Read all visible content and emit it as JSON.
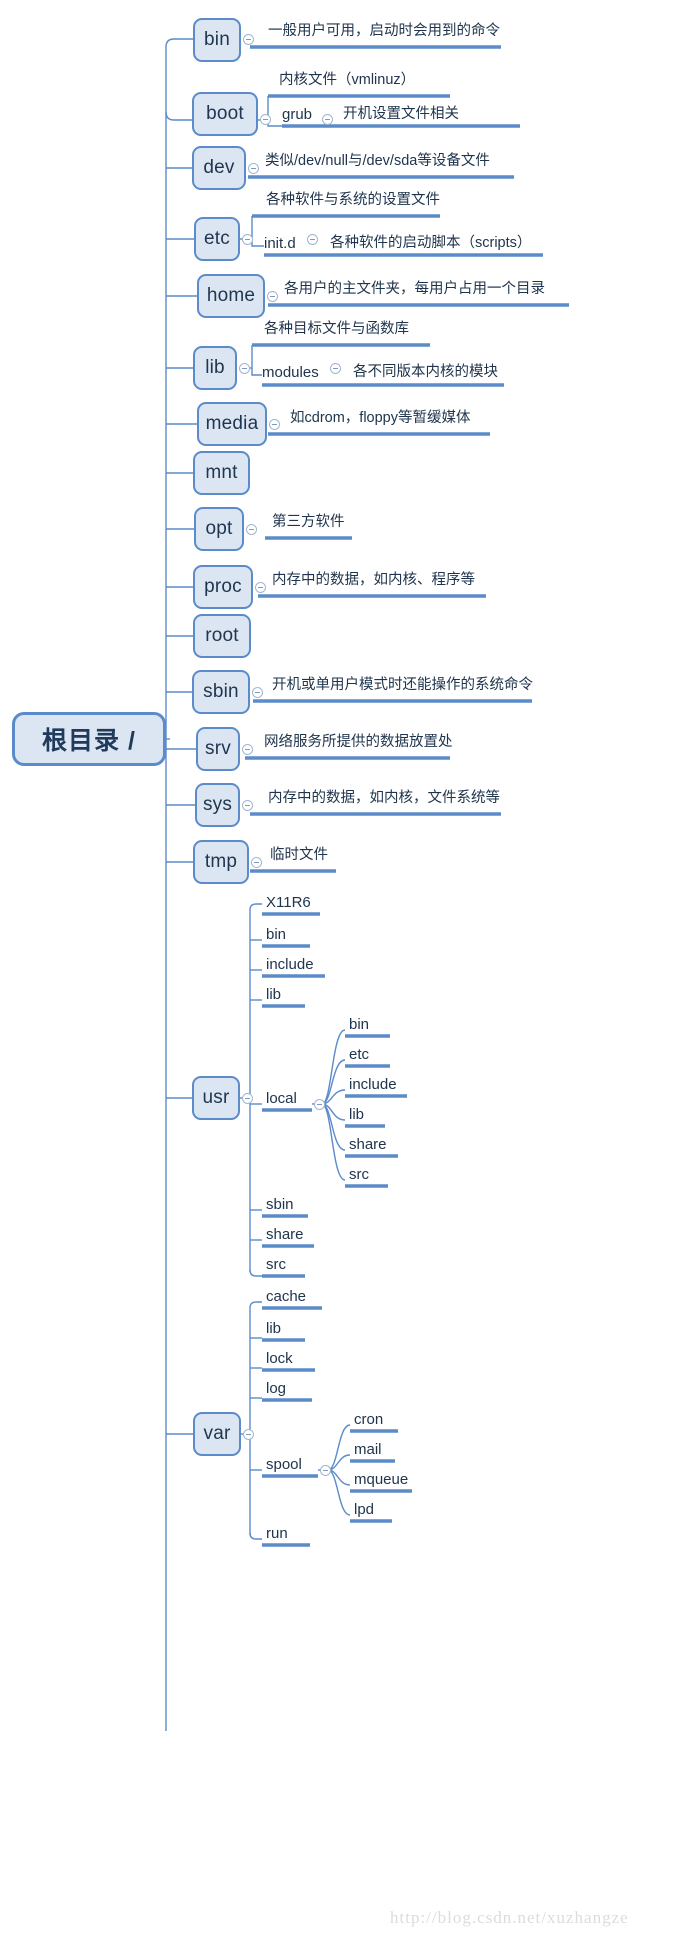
{
  "meta": {
    "title": "Linux 根目录结构思维导图",
    "watermark": "http://blog.csdn.net/xuzhangze",
    "colors": {
      "node_fill": "#dce6f2",
      "node_border": "#5b8bc9",
      "wire": "#5b8bc9",
      "underline": "#5b8bc9",
      "text": "#20354d",
      "watermark": "#dcdcdc",
      "background": "#ffffff"
    }
  },
  "root": {
    "label": "根目录 /"
  },
  "branches": [
    {
      "id": "bin",
      "label": "bin",
      "note": "一般用户可用，启动时会用到的命令",
      "children": []
    },
    {
      "id": "boot",
      "label": "boot",
      "note": "内核文件（vmlinuz）",
      "children": [
        {
          "label": "grub",
          "note": "开机设置文件相关"
        }
      ]
    },
    {
      "id": "dev",
      "label": "dev",
      "note": "类似/dev/null与/dev/sda等设备文件",
      "children": []
    },
    {
      "id": "etc",
      "label": "etc",
      "note": "各种软件与系统的设置文件",
      "children": [
        {
          "label": "init.d",
          "note": "各种软件的启动脚本（scripts）"
        }
      ]
    },
    {
      "id": "home",
      "label": "home",
      "note": "各用户的主文件夹，每用户占用一个目录",
      "children": []
    },
    {
      "id": "lib",
      "label": "lib",
      "note": "各种目标文件与函数库",
      "children": [
        {
          "label": "modules",
          "note": "各不同版本内核的模块"
        }
      ]
    },
    {
      "id": "media",
      "label": "media",
      "note": "如cdrom，floppy等暂缓媒体",
      "children": []
    },
    {
      "id": "mnt",
      "label": "mnt",
      "note": "",
      "children": []
    },
    {
      "id": "opt",
      "label": "opt",
      "note": "第三方软件",
      "children": []
    },
    {
      "id": "proc",
      "label": "proc",
      "note": "内存中的数据，如内核、程序等",
      "children": []
    },
    {
      "id": "root",
      "label": "root",
      "note": "",
      "children": []
    },
    {
      "id": "sbin",
      "label": "sbin",
      "note": "开机或单用户模式时还能操作的系统命令",
      "children": []
    },
    {
      "id": "srv",
      "label": "srv",
      "note": "网络服务所提供的数据放置处",
      "children": []
    },
    {
      "id": "sys",
      "label": "sys",
      "note": "内存中的数据，如内核，文件系统等",
      "children": []
    },
    {
      "id": "tmp",
      "label": "tmp",
      "note": "临时文件",
      "children": []
    },
    {
      "id": "usr",
      "label": "usr",
      "note": "",
      "children": [
        {
          "label": "X11R6"
        },
        {
          "label": "bin"
        },
        {
          "label": "include"
        },
        {
          "label": "lib"
        },
        {
          "label": "local",
          "children": [
            {
              "label": "bin"
            },
            {
              "label": "etc"
            },
            {
              "label": "include"
            },
            {
              "label": "lib"
            },
            {
              "label": "share"
            },
            {
              "label": "src"
            }
          ]
        },
        {
          "label": "sbin"
        },
        {
          "label": "share"
        },
        {
          "label": "src"
        }
      ]
    },
    {
      "id": "var",
      "label": "var",
      "note": "",
      "children": [
        {
          "label": "cache"
        },
        {
          "label": "lib"
        },
        {
          "label": "lock"
        },
        {
          "label": "log"
        },
        {
          "label": "spool",
          "children": [
            {
              "label": "cron"
            },
            {
              "label": "mail"
            },
            {
              "label": "mqueue"
            },
            {
              "label": "lpd"
            }
          ]
        },
        {
          "label": "run"
        }
      ]
    }
  ]
}
